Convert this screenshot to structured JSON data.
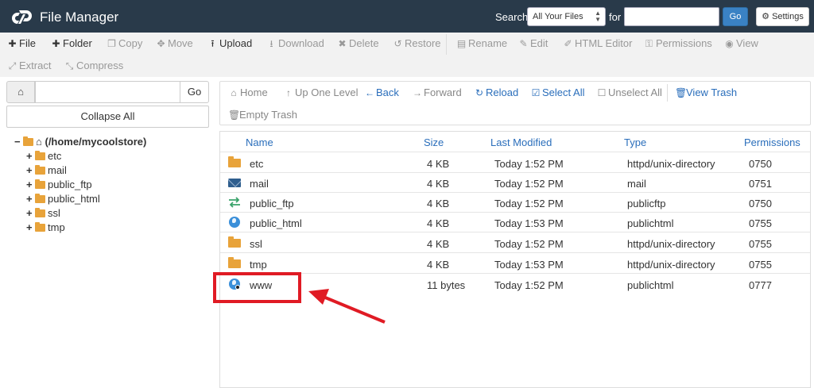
{
  "header": {
    "title": "File Manager",
    "search_label": "Search",
    "search_scope": "All Your Files",
    "for_label": "for",
    "search_query": "",
    "go_label": "Go",
    "settings_label": "Settings"
  },
  "toolbar": {
    "items": [
      {
        "label": "File",
        "icon": "plus-icon",
        "enabled": true
      },
      {
        "label": "Folder",
        "icon": "plus-icon",
        "enabled": true
      },
      {
        "label": "Copy",
        "icon": "copy-icon",
        "enabled": false
      },
      {
        "label": "Move",
        "icon": "move-icon",
        "enabled": false
      },
      {
        "label": "Upload",
        "icon": "upload-icon",
        "enabled": true
      },
      {
        "label": "Download",
        "icon": "download-icon",
        "enabled": false
      },
      {
        "label": "Delete",
        "icon": "delete-icon",
        "enabled": false
      },
      {
        "label": "Restore",
        "icon": "restore-icon",
        "enabled": false
      },
      {
        "label": "Rename",
        "icon": "rename-icon",
        "enabled": false
      },
      {
        "label": "Edit",
        "icon": "pencil-icon",
        "enabled": false
      },
      {
        "label": "HTML Editor",
        "icon": "html-editor-icon",
        "enabled": false
      },
      {
        "label": "Permissions",
        "icon": "key-icon",
        "enabled": false
      },
      {
        "label": "View",
        "icon": "eye-icon",
        "enabled": false
      },
      {
        "label": "Extract",
        "icon": "expand-icon",
        "enabled": false
      },
      {
        "label": "Compress",
        "icon": "compress-icon",
        "enabled": false
      }
    ]
  },
  "left": {
    "path_value": "",
    "go_label": "Go",
    "collapse_label": "Collapse All",
    "root_label": "(/home/mycoolstore)",
    "tree": [
      {
        "label": "etc"
      },
      {
        "label": "mail"
      },
      {
        "label": "public_ftp"
      },
      {
        "label": "public_html"
      },
      {
        "label": "ssl"
      },
      {
        "label": "tmp"
      }
    ]
  },
  "nav": {
    "home": "Home",
    "up": "Up One Level",
    "back": "Back",
    "forward": "Forward",
    "reload": "Reload",
    "select_all": "Select All",
    "unselect_all": "Unselect All",
    "view_trash": "View Trash",
    "empty_trash": "Empty Trash"
  },
  "table": {
    "headers": [
      "Name",
      "Size",
      "Last Modified",
      "Type",
      "Permissions"
    ],
    "rows": [
      {
        "icon": "folder-icon",
        "name": "etc",
        "size": "4 KB",
        "modified": "Today 1:52 PM",
        "type": "httpd/unix-directory",
        "perms": "0750"
      },
      {
        "icon": "mail-icon",
        "name": "mail",
        "size": "4 KB",
        "modified": "Today 1:52 PM",
        "type": "mail",
        "perms": "0751"
      },
      {
        "icon": "ftp-arrows-icon",
        "name": "public_ftp",
        "size": "4 KB",
        "modified": "Today 1:52 PM",
        "type": "publicftp",
        "perms": "0750"
      },
      {
        "icon": "globe-icon",
        "name": "public_html",
        "size": "4 KB",
        "modified": "Today 1:53 PM",
        "type": "publichtml",
        "perms": "0755"
      },
      {
        "icon": "folder-icon",
        "name": "ssl",
        "size": "4 KB",
        "modified": "Today 1:52 PM",
        "type": "httpd/unix-directory",
        "perms": "0755"
      },
      {
        "icon": "folder-icon",
        "name": "tmp",
        "size": "4 KB",
        "modified": "Today 1:53 PM",
        "type": "httpd/unix-directory",
        "perms": "0755"
      },
      {
        "icon": "globe-link-icon",
        "name": "www",
        "size": "11 bytes",
        "modified": "Today 1:52 PM",
        "type": "publichtml",
        "perms": "0777"
      }
    ]
  },
  "colors": {
    "header_bg": "#293a4a",
    "link_blue": "#2a6ebb",
    "folder_orange": "#e8a33a",
    "annotation_red": "#e01b24"
  }
}
